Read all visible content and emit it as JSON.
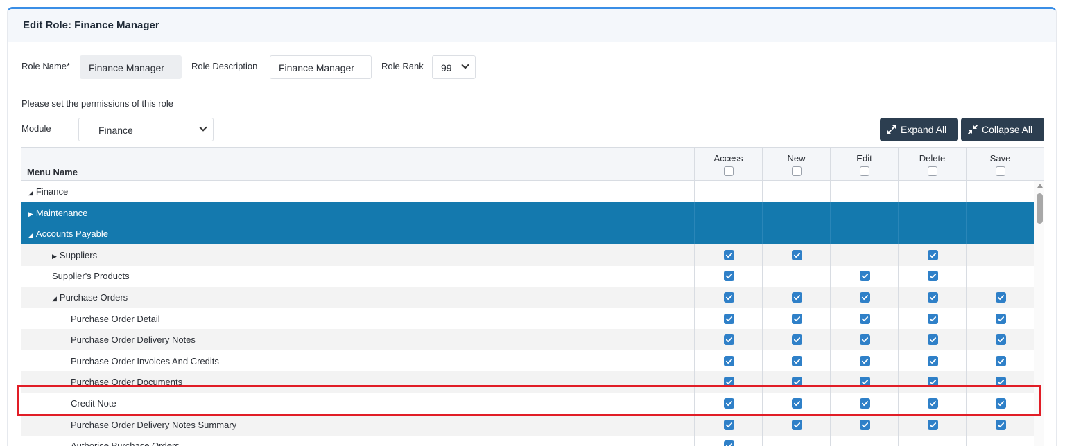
{
  "header": {
    "title": "Edit Role: Finance Manager"
  },
  "form": {
    "role_name_label": "Role Name*",
    "role_name_value": "Finance Manager",
    "role_desc_label": "Role Description",
    "role_desc_value": "Finance Manager",
    "role_rank_label": "Role Rank",
    "role_rank_value": "99",
    "instructions": "Please set the permissions of this role",
    "module_label": "Module",
    "module_value": "Finance"
  },
  "toolbar": {
    "expand_label": "Expand All",
    "collapse_label": "Collapse All"
  },
  "grid": {
    "menu_header": "Menu Name",
    "columns": [
      "Access",
      "New",
      "Edit",
      "Delete",
      "Save"
    ],
    "rows": [
      {
        "label": "Finance",
        "toggle": "◢",
        "level": 0,
        "style": "plain",
        "checks": [
          false,
          false,
          false,
          false,
          false
        ]
      },
      {
        "label": "Maintenance",
        "toggle": "▶",
        "level": 0,
        "style": "selected",
        "checks": [
          false,
          false,
          false,
          false,
          false
        ]
      },
      {
        "label": "Accounts Payable",
        "toggle": "◢",
        "level": 0,
        "style": "selected",
        "checks": [
          false,
          false,
          false,
          false,
          false
        ]
      },
      {
        "label": "Suppliers",
        "toggle": "▶",
        "level": 1,
        "style": "alt",
        "checks": [
          true,
          true,
          false,
          true,
          false
        ]
      },
      {
        "label": "Supplier's Products",
        "toggle": "",
        "level": 1,
        "style": "plain",
        "checks": [
          true,
          false,
          true,
          true,
          false
        ]
      },
      {
        "label": "Purchase Orders",
        "toggle": "◢",
        "level": 1,
        "style": "alt",
        "checks": [
          true,
          true,
          true,
          true,
          true
        ]
      },
      {
        "label": "Purchase Order Detail",
        "toggle": "",
        "level": 2,
        "style": "plain",
        "checks": [
          true,
          true,
          true,
          true,
          true
        ]
      },
      {
        "label": "Purchase Order Delivery Notes",
        "toggle": "",
        "level": 2,
        "style": "alt",
        "checks": [
          true,
          true,
          true,
          true,
          true
        ]
      },
      {
        "label": "Purchase Order Invoices And Credits",
        "toggle": "",
        "level": 2,
        "style": "plain",
        "checks": [
          true,
          true,
          true,
          true,
          true
        ]
      },
      {
        "label": "Purchase Order Documents",
        "toggle": "",
        "level": 2,
        "style": "alt",
        "checks": [
          true,
          true,
          true,
          true,
          true
        ]
      },
      {
        "label": "Credit Note",
        "toggle": "",
        "level": 2,
        "style": "plain",
        "checks": [
          true,
          true,
          true,
          true,
          true
        ]
      },
      {
        "label": "Purchase Order Delivery Notes Summary",
        "toggle": "",
        "level": 2,
        "style": "alt",
        "checks": [
          true,
          true,
          true,
          true,
          true
        ]
      },
      {
        "label": "Authorise Purchase Orders",
        "toggle": "",
        "level": 2,
        "style": "plain",
        "checks": [
          true,
          false,
          false,
          false,
          false
        ]
      }
    ]
  },
  "colors": {
    "accent": "#3a8ee6",
    "selected_row": "#1479ae",
    "checkbox": "#2f80c8",
    "button": "#2c3e50",
    "highlight": "#e11d26"
  },
  "icons": {
    "expand": "expand-arrows-icon",
    "collapse": "collapse-arrows-icon",
    "check": "check-icon"
  }
}
